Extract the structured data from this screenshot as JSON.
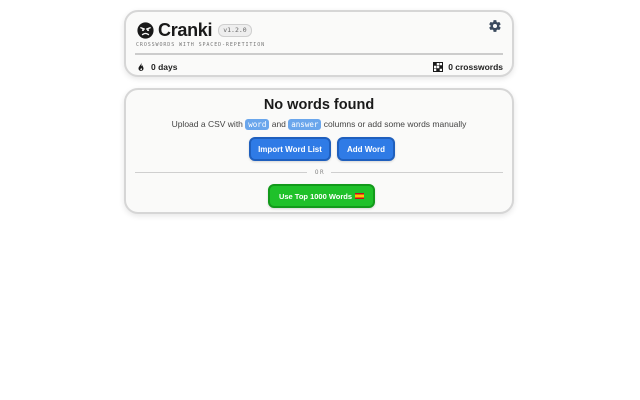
{
  "header": {
    "logo_icon": "angry-face-icon",
    "title": "Cranki",
    "version": "v1.2.0",
    "tagline": "CROSSWORDS WITH SPACED-REPETITION",
    "settings_icon": "gear-icon",
    "streak_icon": "flame-icon",
    "streak_label": "0 days",
    "crosswords_icon": "crossword-grid-icon",
    "crosswords_label": "0 crosswords"
  },
  "main": {
    "title": "No words found",
    "instructions": {
      "before": "Upload a CSV with",
      "chip_word": "word",
      "and": "and",
      "chip_answer": "answer",
      "after": "columns or add some words manually"
    },
    "import_button": "Import Word List",
    "add_button": "Add Word",
    "or_label": "OR",
    "top_words_button": "Use Top 1000 Words",
    "top_words_flag_icon": "spain-flag-icon"
  },
  "colors": {
    "primary_blue": "#2f7be6",
    "success_green": "#1fc12a",
    "chip_blue": "#6aa6ec"
  }
}
